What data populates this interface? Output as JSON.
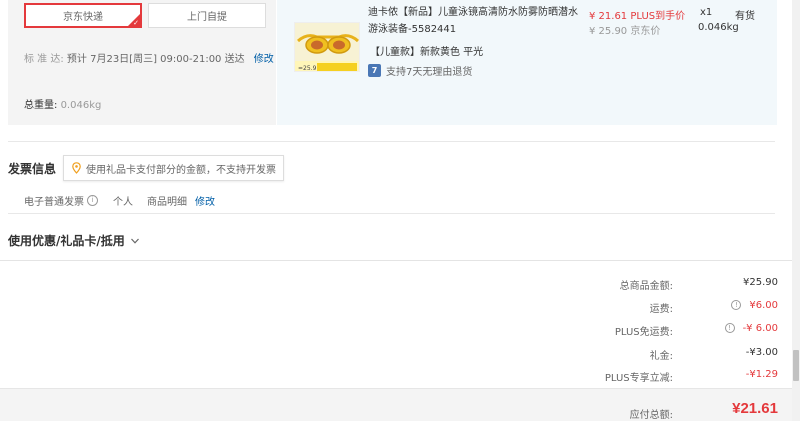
{
  "shipping": {
    "option_jd": "京东快递",
    "option_pickup": "上门自提",
    "delivery_label": "标 准 达:",
    "delivery_value": "预计 7月23日[周三] 09:00-21:00 送达",
    "delivery_edit": "修改",
    "weight_label": "总重量:",
    "weight_value": "0.046kg"
  },
  "product": {
    "title": "迪卡侬【新品】儿童泳镜高清防水防雾防晒潜水游泳装备-5582441",
    "spec": "【儿童款】新款黄色 平光",
    "return_badge": "7",
    "return_text": "支持7天无理由退货",
    "plus_price": "¥ 21.61 PLUS到手价",
    "jd_price": "¥ 25.90 京东价",
    "qty": "x1",
    "stock": "有货",
    "weight": "0.046kg",
    "thumb_caption": "=25.9"
  },
  "invoice": {
    "title": "发票信息",
    "tip": "使用礼品卡支付部分的金额，不支持开发票",
    "type": "电子普通发票",
    "info_icon": "i",
    "holder": "个人",
    "content": "商品明细",
    "edit": "修改"
  },
  "coupon": {
    "title": "使用优惠/礼品卡/抵用"
  },
  "summary": {
    "goods_label": "总商品金额:",
    "goods_value": "¥25.90",
    "freight_label": "运费:",
    "freight_value": "¥6.00",
    "plus_free_label": "PLUS免运费:",
    "plus_free_value": "-¥ 6.00",
    "gift_label": "礼金:",
    "gift_value": "-¥3.00",
    "plus_discount_label": "PLUS专享立减:",
    "plus_discount_value": "-¥1.29",
    "total_label": "应付总额:",
    "total_value": "¥21.61"
  },
  "colors": {
    "accent_red": "#e4393c",
    "link_blue": "#005ea7",
    "panel_blue": "#f2f8fb"
  }
}
